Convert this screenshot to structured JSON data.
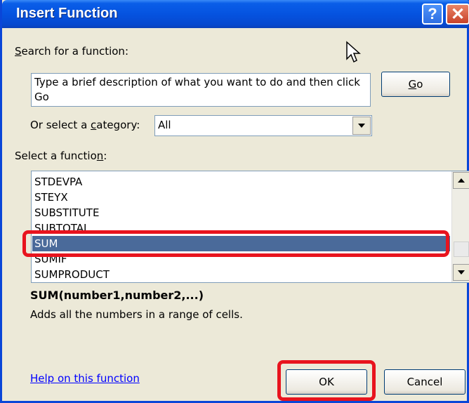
{
  "window": {
    "title": "Insert Function",
    "help_button": "?",
    "close_button": "✕"
  },
  "search": {
    "label_mnemonic": "S",
    "label_rest": "earch for a function:",
    "value": "Type a brief description of what you want to do and then click Go",
    "go_mnemonic": "G",
    "go_rest": "o"
  },
  "category": {
    "label_pre": "Or select a ",
    "label_mnemonic": "c",
    "label_post": "ategory:",
    "value": "All"
  },
  "functions": {
    "label_pre": "Select a functio",
    "label_mnemonic": "n",
    "label_post": ":",
    "items": [
      "STDEVPA",
      "STEYX",
      "SUBSTITUTE",
      "SUBTOTAL",
      "SUM",
      "SUMIF",
      "SUMPRODUCT"
    ],
    "selected": "SUM"
  },
  "details": {
    "signature": "SUM(number1,number2,...)",
    "description": "Adds all the numbers in a range of cells."
  },
  "footer": {
    "help_link": "Help on this function",
    "ok": "OK",
    "cancel": "Cancel"
  },
  "colors": {
    "highlight": "#e8141e",
    "selection": "#4a6a9a",
    "title_bar": "#0553e0"
  }
}
